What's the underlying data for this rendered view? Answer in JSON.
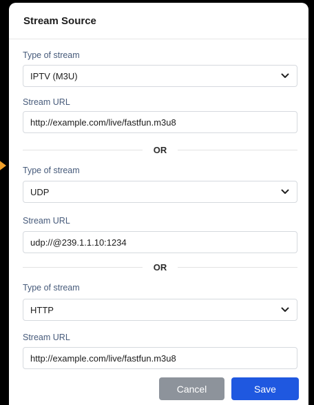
{
  "dialog": {
    "title": "Stream Source"
  },
  "sources": [
    {
      "type_label": "Type of stream",
      "type_value": "IPTV (M3U)",
      "url_label": "Stream URL",
      "url_value": "http://example.com/live/fastfun.m3u8"
    },
    {
      "type_label": "Type of stream",
      "type_value": "UDP",
      "url_label": "Stream URL",
      "url_value": "udp://@239.1.1.10:1234"
    },
    {
      "type_label": "Type of stream",
      "type_value": "HTTP",
      "url_label": "Stream URL",
      "url_value": "http://example.com/live/fastfun.m3u8"
    }
  ],
  "dividers": [
    "OR",
    "OR"
  ],
  "buttons": {
    "cancel": "Cancel",
    "save": "Save"
  },
  "colors": {
    "accent": "#1f58e0",
    "cancel": "#8d939b",
    "side_arrow": "#f0a02a",
    "label": "#465a7a"
  },
  "icons": {
    "select_chevron": "chevron-down-icon",
    "side_marker": "arrow-right-icon"
  }
}
